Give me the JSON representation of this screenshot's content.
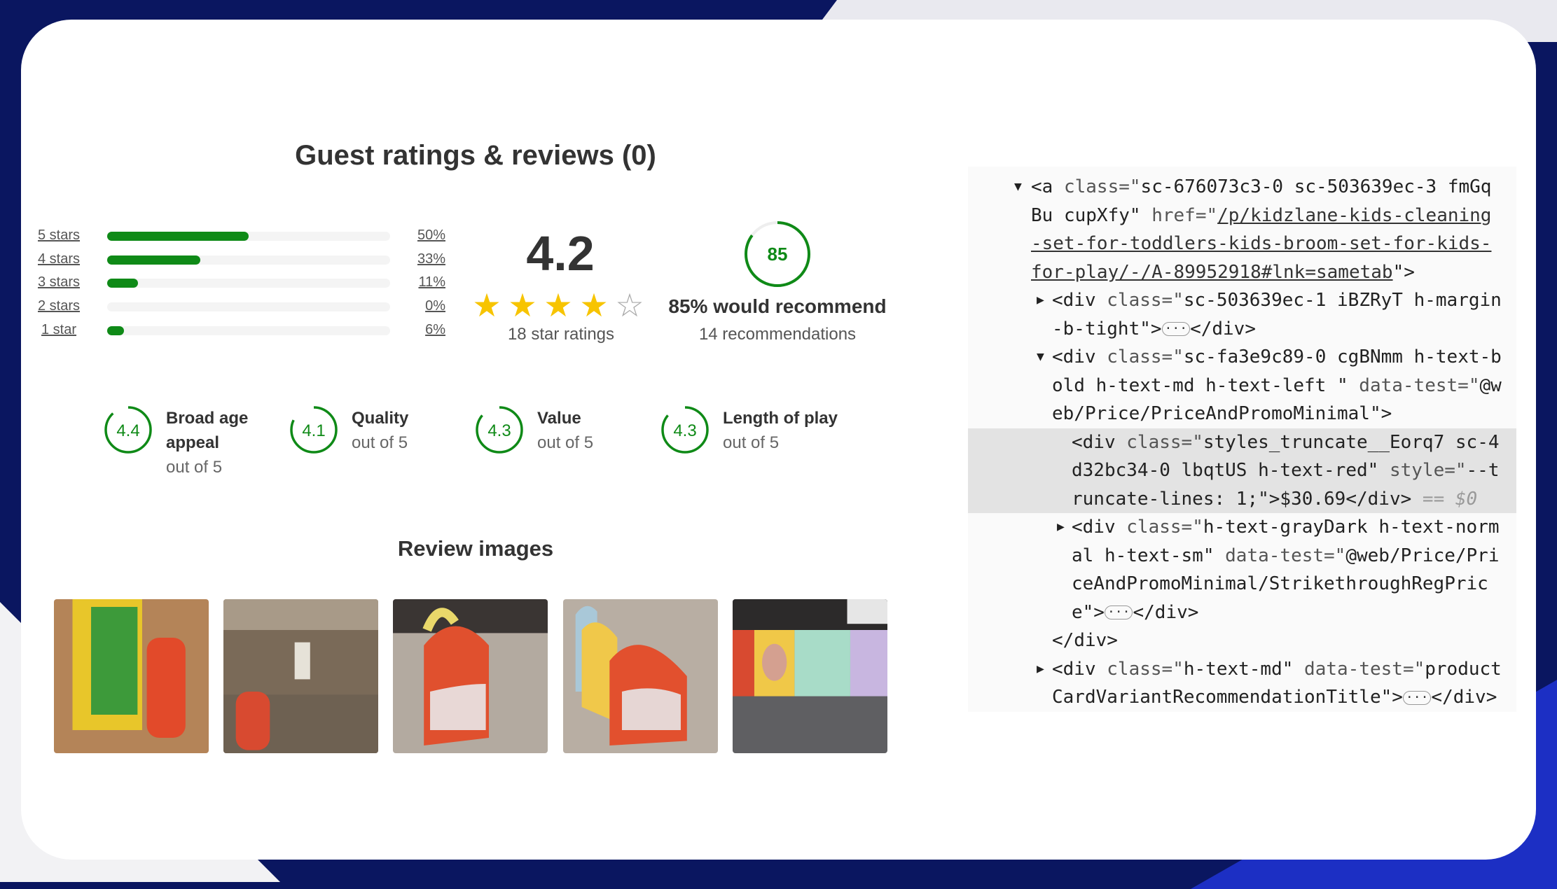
{
  "colors": {
    "accent_green": "#0f8a17",
    "star_gold": "#f7c400",
    "navy_bg": "#0a1660",
    "blue_corner": "#1c2fc4"
  },
  "reviews": {
    "title": "Guest ratings & reviews (0)",
    "distribution": [
      {
        "label": "5 stars",
        "percent_label": "50%",
        "percent": 50
      },
      {
        "label": "4 stars",
        "percent_label": "33%",
        "percent": 33
      },
      {
        "label": "3 stars",
        "percent_label": "11%",
        "percent": 11
      },
      {
        "label": "2 stars",
        "percent_label": "0%",
        "percent": 0
      },
      {
        "label": "1 star",
        "percent_label": "6%",
        "percent": 6
      }
    ],
    "average": "4.2",
    "star_rating": 4.2,
    "star_count_label": "18 star ratings",
    "recommend_value": "85",
    "recommend_percent": 85,
    "recommend_label": "85% would recommend",
    "recommend_count": "14 recommendations",
    "sub_ratings": [
      {
        "value": "4.4",
        "label_lines": [
          "Broad age",
          "appeal"
        ],
        "sub": "out of 5"
      },
      {
        "value": "4.1",
        "label_lines": [
          "Quality"
        ],
        "sub": "out of 5"
      },
      {
        "value": "4.3",
        "label_lines": [
          "Value"
        ],
        "sub": "out of 5"
      },
      {
        "value": "4.3",
        "label_lines": [
          "Length of play"
        ],
        "sub": "out of 5"
      }
    ],
    "images_title": "Review images",
    "images": [
      "review-image-play-tunnel-box",
      "review-image-room-tunnel",
      "review-image-red-tunnel-face",
      "review-image-tunnel-side",
      "review-image-rainbow-tunnel"
    ]
  },
  "devtools": {
    "lines": [
      {
        "level": 0,
        "arrow": "▼",
        "segs": [
          {
            "t": "<a ",
            "k": "tag"
          },
          {
            "t": "class=\"",
            "k": "attr"
          },
          {
            "t": "sc-676073c3-0 sc-503639ec-3 fmGq",
            "k": "val"
          }
        ]
      },
      {
        "level": 0,
        "segs": [
          {
            "t": "Bu cupXfy\"",
            "k": "val"
          },
          {
            "t": " href=\"",
            "k": "attr"
          },
          {
            "t": "/p/kidzlane-kids-cleaning",
            "k": "link"
          }
        ]
      },
      {
        "level": 0,
        "segs": [
          {
            "t": "-set-for-toddlers-kids-broom-set-for-kids-",
            "k": "link"
          }
        ]
      },
      {
        "level": 0,
        "segs": [
          {
            "t": "for-play/-/A-89952918#lnk=sametab",
            "k": "link"
          },
          {
            "t": "\">",
            "k": "tag"
          }
        ]
      },
      {
        "level": 1,
        "arrow": "▶",
        "segs": [
          {
            "t": "<div ",
            "k": "tag"
          },
          {
            "t": "class=\"",
            "k": "attr"
          },
          {
            "t": "sc-503639ec-1 iBZRyT h-margin",
            "k": "val"
          }
        ]
      },
      {
        "level": 1,
        "segs": [
          {
            "t": "-b-tight\">",
            "k": "val"
          },
          {
            "t": "···",
            "k": "ell"
          },
          {
            "t": "</div>",
            "k": "tag"
          }
        ]
      },
      {
        "level": 1,
        "arrow": "▼",
        "segs": [
          {
            "t": "<div ",
            "k": "tag"
          },
          {
            "t": "class=\"",
            "k": "attr"
          },
          {
            "t": "sc-fa3e9c89-0 cgBNmm h-text-b",
            "k": "val"
          }
        ]
      },
      {
        "level": 1,
        "segs": [
          {
            "t": "old h-text-md h-text-left \"",
            "k": "val"
          },
          {
            "t": " data-test=\"",
            "k": "attr"
          },
          {
            "t": "@w",
            "k": "val"
          }
        ]
      },
      {
        "level": 1,
        "segs": [
          {
            "t": "eb/Price/PriceAndPromoMinimal\">",
            "k": "val"
          }
        ]
      },
      {
        "level": 2,
        "hl": true,
        "segs": [
          {
            "t": "<div ",
            "k": "tag"
          },
          {
            "t": "class=\"",
            "k": "attr"
          },
          {
            "t": "styles_truncate__Eorq7 sc-4",
            "k": "val"
          }
        ]
      },
      {
        "level": 2,
        "hl": true,
        "segs": [
          {
            "t": "d32bc34-0 lbqtUS h-text-red\"",
            "k": "val"
          },
          {
            "t": " style=\"",
            "k": "attr"
          },
          {
            "t": "--t",
            "k": "val"
          }
        ]
      },
      {
        "level": 2,
        "hl": true,
        "segs": [
          {
            "t": "runcate-lines: 1;\">$30.69</div>",
            "k": "val"
          },
          {
            "t": " == $0",
            "k": "dim"
          }
        ]
      },
      {
        "level": 2,
        "arrow": "▶",
        "segs": [
          {
            "t": "<div ",
            "k": "tag"
          },
          {
            "t": "class=\"",
            "k": "attr"
          },
          {
            "t": "h-text-grayDark h-text-norm",
            "k": "val"
          }
        ]
      },
      {
        "level": 2,
        "segs": [
          {
            "t": "al h-text-sm\"",
            "k": "val"
          },
          {
            "t": " data-test=\"",
            "k": "attr"
          },
          {
            "t": "@web/Price/Pri",
            "k": "val"
          }
        ]
      },
      {
        "level": 2,
        "segs": [
          {
            "t": "ceAndPromoMinimal/StrikethroughRegPric",
            "k": "val"
          }
        ]
      },
      {
        "level": 2,
        "segs": [
          {
            "t": "e\">",
            "k": "val"
          },
          {
            "t": "···",
            "k": "ell"
          },
          {
            "t": "</div>",
            "k": "tag"
          }
        ]
      },
      {
        "level": 1,
        "segs": [
          {
            "t": "</div>",
            "k": "tag"
          }
        ]
      },
      {
        "level": 1,
        "arrow": "▶",
        "segs": [
          {
            "t": "<div ",
            "k": "tag"
          },
          {
            "t": "class=\"",
            "k": "attr"
          },
          {
            "t": "h-text-md\"",
            "k": "val"
          },
          {
            "t": " data-test=\"",
            "k": "attr"
          },
          {
            "t": "product",
            "k": "val"
          }
        ]
      },
      {
        "level": 1,
        "segs": [
          {
            "t": "CardVariantRecommendationTitle\">",
            "k": "val"
          },
          {
            "t": "···",
            "k": "ell"
          },
          {
            "t": "</div>",
            "k": "tag"
          }
        ]
      }
    ]
  }
}
